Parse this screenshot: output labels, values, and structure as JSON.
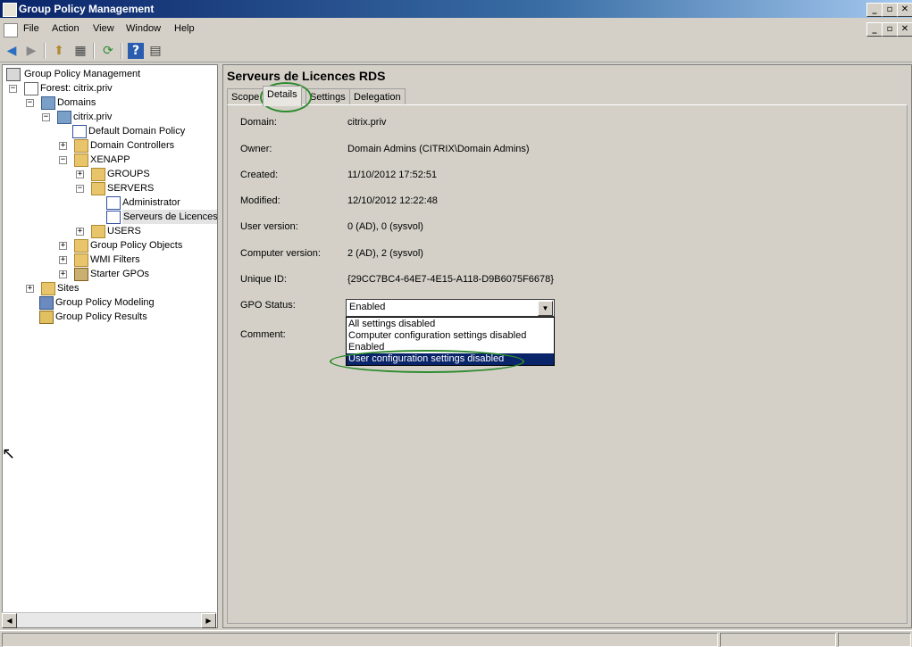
{
  "window": {
    "title": "Group Policy Management",
    "minimize_glyph": "_",
    "restore_glyph": "▫",
    "close_glyph": "✕"
  },
  "menu": {
    "items": [
      "File",
      "Action",
      "View",
      "Window",
      "Help"
    ]
  },
  "toolbar": {
    "buttons": [
      {
        "name": "back-icon",
        "glyph": "◀"
      },
      {
        "name": "forward-icon",
        "glyph": "▶"
      },
      {
        "name": "up-folder-icon",
        "glyph": "⬆"
      },
      {
        "name": "show-tree-icon",
        "glyph": "▦"
      },
      {
        "name": "refresh-icon",
        "glyph": "⟳"
      },
      {
        "name": "help-icon",
        "glyph": "?"
      },
      {
        "name": "properties-icon",
        "glyph": "▤"
      }
    ]
  },
  "tree": {
    "items": [
      {
        "label": "Group Policy Management",
        "icon": "root",
        "expander": ""
      },
      {
        "label": "Forest: citrix.priv",
        "icon": "forest",
        "expander": "−"
      },
      {
        "label": "Domains",
        "icon": "domain",
        "expander": "−"
      },
      {
        "label": "citrix.priv",
        "icon": "domain",
        "expander": "−"
      },
      {
        "label": "Default Domain Policy",
        "icon": "gpl",
        "expander": ""
      },
      {
        "label": "Domain Controllers",
        "icon": "folder",
        "expander": "+"
      },
      {
        "label": "XENAPP",
        "icon": "folder",
        "expander": "−"
      },
      {
        "label": "GROUPS",
        "icon": "folder",
        "expander": "+"
      },
      {
        "label": "SERVERS",
        "icon": "folder",
        "expander": "−"
      },
      {
        "label": "Administrator",
        "icon": "gpl",
        "expander": ""
      },
      {
        "label": "Serveurs de Licences",
        "icon": "gpl",
        "expander": "",
        "selected": true
      },
      {
        "label": "USERS",
        "icon": "folder",
        "expander": "+"
      },
      {
        "label": "Group Policy Objects",
        "icon": "folder",
        "expander": "+"
      },
      {
        "label": "WMI Filters",
        "icon": "wmi",
        "expander": "+"
      },
      {
        "label": "Starter GPOs",
        "icon": "starter",
        "expander": "+"
      },
      {
        "label": "Sites",
        "icon": "site",
        "expander": "+"
      },
      {
        "label": "Group Policy Modeling",
        "icon": "model",
        "expander": ""
      },
      {
        "label": "Group Policy Results",
        "icon": "results",
        "expander": ""
      }
    ]
  },
  "scroll": {
    "left_glyph": "◀",
    "right_glyph": "▶",
    "down_glyph": "▼"
  },
  "detail": {
    "title": "Serveurs de Licences RDS",
    "tabs": [
      "Scope",
      "Details",
      "Settings",
      "Delegation"
    ],
    "active_tab": "Details",
    "fields": [
      {
        "label": "Domain:",
        "value": "citrix.priv"
      },
      {
        "label": "Owner:",
        "value": "Domain Admins (CITRIX\\Domain Admins)"
      },
      {
        "label": "Created:",
        "value": "11/10/2012 17:52:51"
      },
      {
        "label": "Modified:",
        "value": "12/10/2012 12:22:48"
      },
      {
        "label": "User version:",
        "value": "0 (AD), 0 (sysvol)"
      },
      {
        "label": "Computer version:",
        "value": "2 (AD), 2 (sysvol)"
      },
      {
        "label": "Unique ID:",
        "value": "{29CC7BC4-64E7-4E15-A118-D9B6075F6678}"
      }
    ],
    "gpo_status_label": "GPO Status:",
    "gpo_status_value": "Enabled",
    "comment_label": "Comment:",
    "status_options": [
      "All settings disabled",
      "Computer configuration settings disabled",
      "Enabled",
      "User configuration settings disabled"
    ],
    "highlighted_option": "User configuration settings disabled"
  },
  "colors": {
    "accent": "#0a246a",
    "annotation": "#2e8b2e"
  }
}
